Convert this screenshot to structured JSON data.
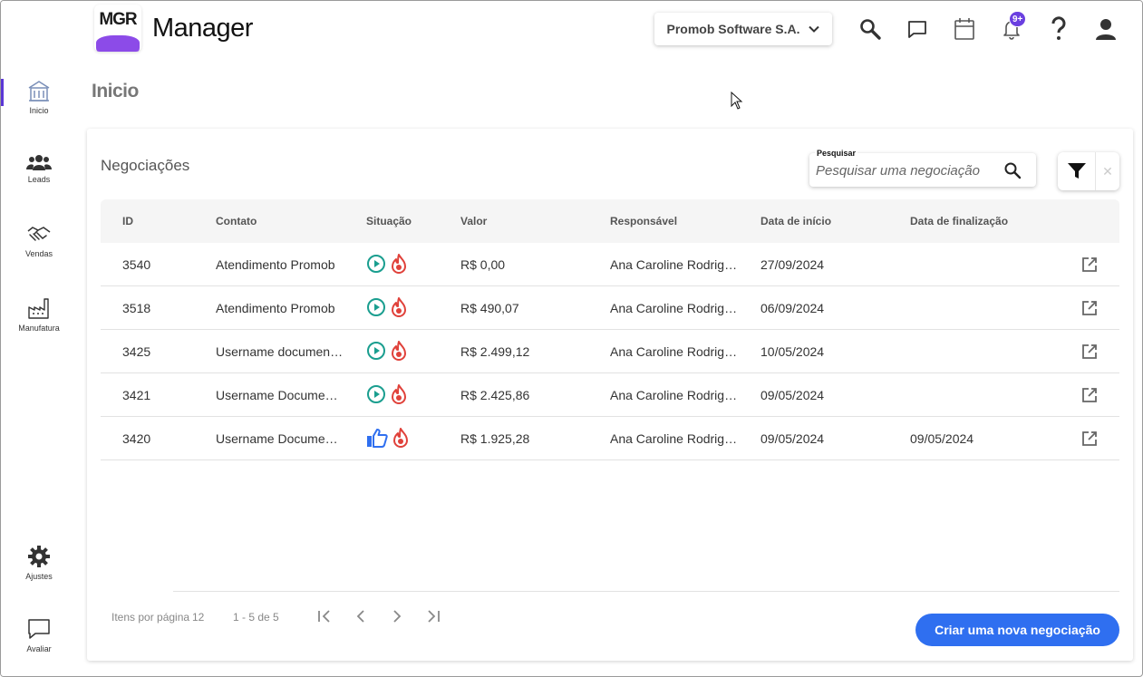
{
  "header": {
    "logo_text": "MGR",
    "app_title": "Manager",
    "company": "Promob Software S.A.",
    "notifications_badge": "9+",
    "icons": [
      "search-icon",
      "chat-icon",
      "calendar-icon",
      "bell-icon",
      "help-icon",
      "user-icon"
    ]
  },
  "sidebar": {
    "items": [
      {
        "label": "Inicio",
        "icon": "building-icon"
      },
      {
        "label": "Leads",
        "icon": "people-icon"
      },
      {
        "label": "Vendas",
        "icon": "handshake-icon"
      },
      {
        "label": "Manufatura",
        "icon": "factory-icon"
      },
      {
        "label": "Ajustes",
        "icon": "gear-icon"
      },
      {
        "label": "Avaliar",
        "icon": "chat-icon"
      }
    ]
  },
  "page": {
    "title": "Inicio"
  },
  "card": {
    "title": "Negociações",
    "search": {
      "label": "Pesquisar",
      "placeholder": "Pesquisar uma negociação"
    },
    "clear_symbol": "✕"
  },
  "table": {
    "columns": [
      "ID",
      "Contato",
      "Situação",
      "Valor",
      "Responsável",
      "Data de início",
      "Data de finalização"
    ],
    "rows": [
      {
        "id": "3540",
        "contact": "Atendimento Promob",
        "status": "play",
        "value": "R$ 0,00",
        "owner": "Ana Caroline Rodrigues",
        "start": "27/09/2024",
        "end": ""
      },
      {
        "id": "3518",
        "contact": "Atendimento Promob",
        "status": "play",
        "value": "R$ 490,07",
        "owner": "Ana Caroline Rodrigues",
        "start": "06/09/2024",
        "end": ""
      },
      {
        "id": "3425",
        "contact": "Username documentation",
        "status": "play",
        "value": "R$ 2.499,12",
        "owner": "Ana Caroline Rodrigues",
        "start": "10/05/2024",
        "end": ""
      },
      {
        "id": "3421",
        "contact": "Username Documentation",
        "status": "play",
        "value": "R$ 2.425,86",
        "owner": "Ana Caroline Rodrigues",
        "start": "09/05/2024",
        "end": ""
      },
      {
        "id": "3420",
        "contact": "Username Documentation",
        "status": "won",
        "value": "R$ 1.925,28",
        "owner": "Ana Caroline Rodrigues",
        "start": "09/05/2024",
        "end": "09/05/2024"
      }
    ]
  },
  "footer": {
    "items_per_page_label": "Itens por página",
    "items_per_page": "12",
    "range": "1 - 5 de 5",
    "create_button": "Criar uma nova negociação"
  },
  "colors": {
    "accent": "#5b37d6",
    "primary_button": "#2f6ff0",
    "status_play": "#1a9e8f",
    "status_hot": "#e0413a",
    "status_won": "#2f6ff0"
  }
}
